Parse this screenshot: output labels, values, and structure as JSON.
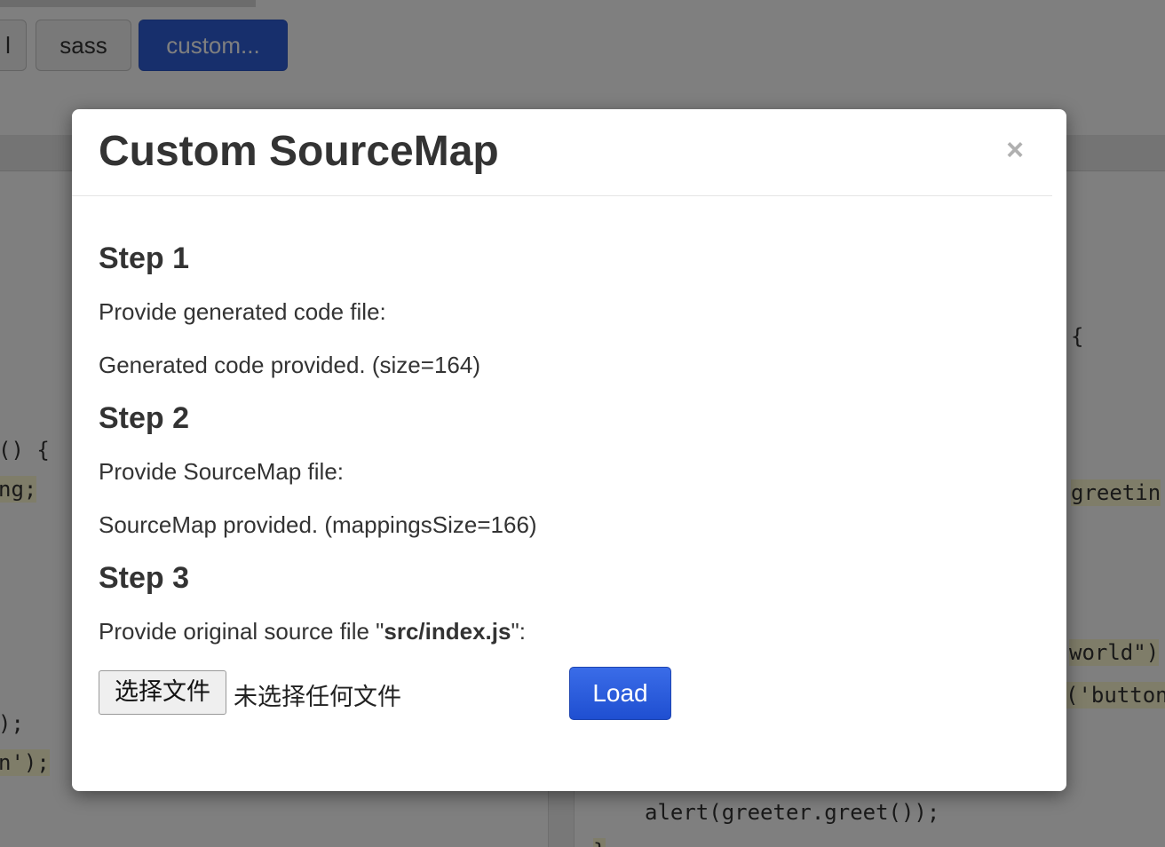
{
  "background": {
    "tabs": [
      {
        "label": "l"
      },
      {
        "label": "sass"
      },
      {
        "label": "custom..."
      }
    ],
    "code_left": [
      "() {",
      "ng;",
      ");",
      "n');"
    ],
    "code_right": [
      "{",
      "greetin",
      "world\")",
      "('button",
      "alert(greeter.greet());",
      "}"
    ]
  },
  "modal": {
    "title": "Custom SourceMap",
    "close_label": "×",
    "step1": {
      "heading": "Step 1",
      "prompt": "Provide generated code file:",
      "status": "Generated code provided. (size=164)"
    },
    "step2": {
      "heading": "Step 2",
      "prompt": "Provide SourceMap file:",
      "status": "SourceMap provided. (mappingsSize=166)"
    },
    "step3": {
      "heading": "Step 3",
      "prompt_prefix": "Provide original source file \"",
      "filename": "src/index.js",
      "prompt_suffix": "\":",
      "file_button_label": "选择文件",
      "file_status": "未选择任何文件",
      "load_label": "Load"
    }
  },
  "colors": {
    "primary_button": "#2f5ed8",
    "overlay": "#000000"
  }
}
